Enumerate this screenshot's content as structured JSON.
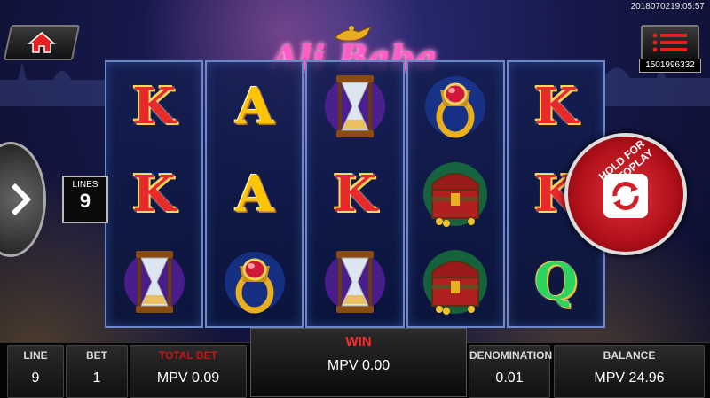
{
  "timestamp": "2018070219:05:57",
  "account_number": "1501996332",
  "logo": "Ali Baba",
  "lines_panel": {
    "label": "LINES",
    "value": "9"
  },
  "autoplay_text": "HOLD FOR AUTOPLAY",
  "reels": [
    [
      {
        "kind": "letter",
        "text": "K",
        "cls": "k"
      },
      {
        "kind": "letter",
        "text": "K",
        "cls": "k"
      },
      {
        "kind": "icon",
        "name": "hourglass-icon"
      }
    ],
    [
      {
        "kind": "letter",
        "text": "A",
        "cls": "a"
      },
      {
        "kind": "letter",
        "text": "A",
        "cls": "a"
      },
      {
        "kind": "icon",
        "name": "ring-icon"
      }
    ],
    [
      {
        "kind": "icon",
        "name": "hourglass-icon"
      },
      {
        "kind": "letter",
        "text": "K",
        "cls": "k"
      },
      {
        "kind": "icon",
        "name": "hourglass-icon"
      }
    ],
    [
      {
        "kind": "icon",
        "name": "ring-icon"
      },
      {
        "kind": "icon",
        "name": "treasure-chest-icon"
      },
      {
        "kind": "icon",
        "name": "treasure-chest-icon"
      }
    ],
    [
      {
        "kind": "letter",
        "text": "K",
        "cls": "k"
      },
      {
        "kind": "letter",
        "text": "K",
        "cls": "k"
      },
      {
        "kind": "letter",
        "text": "Q",
        "cls": "q"
      }
    ]
  ],
  "bottom": {
    "line_label": "LINE",
    "line_value": "9",
    "bet_label": "BET",
    "bet_value": "1",
    "total_bet_label": "TOTAL BET",
    "total_bet_value": "MPV 0.09",
    "win_label": "WIN",
    "win_value": "MPV 0.00",
    "denomination_label": "DENOMINATION",
    "denomination_value": "0.01",
    "balance_label": "BALANCE",
    "balance_value": "MPV 24.96"
  },
  "colors": {
    "total_bet_label": "#c01818",
    "win_label": "#ff2a2a",
    "autoplay": "#d0202a"
  }
}
